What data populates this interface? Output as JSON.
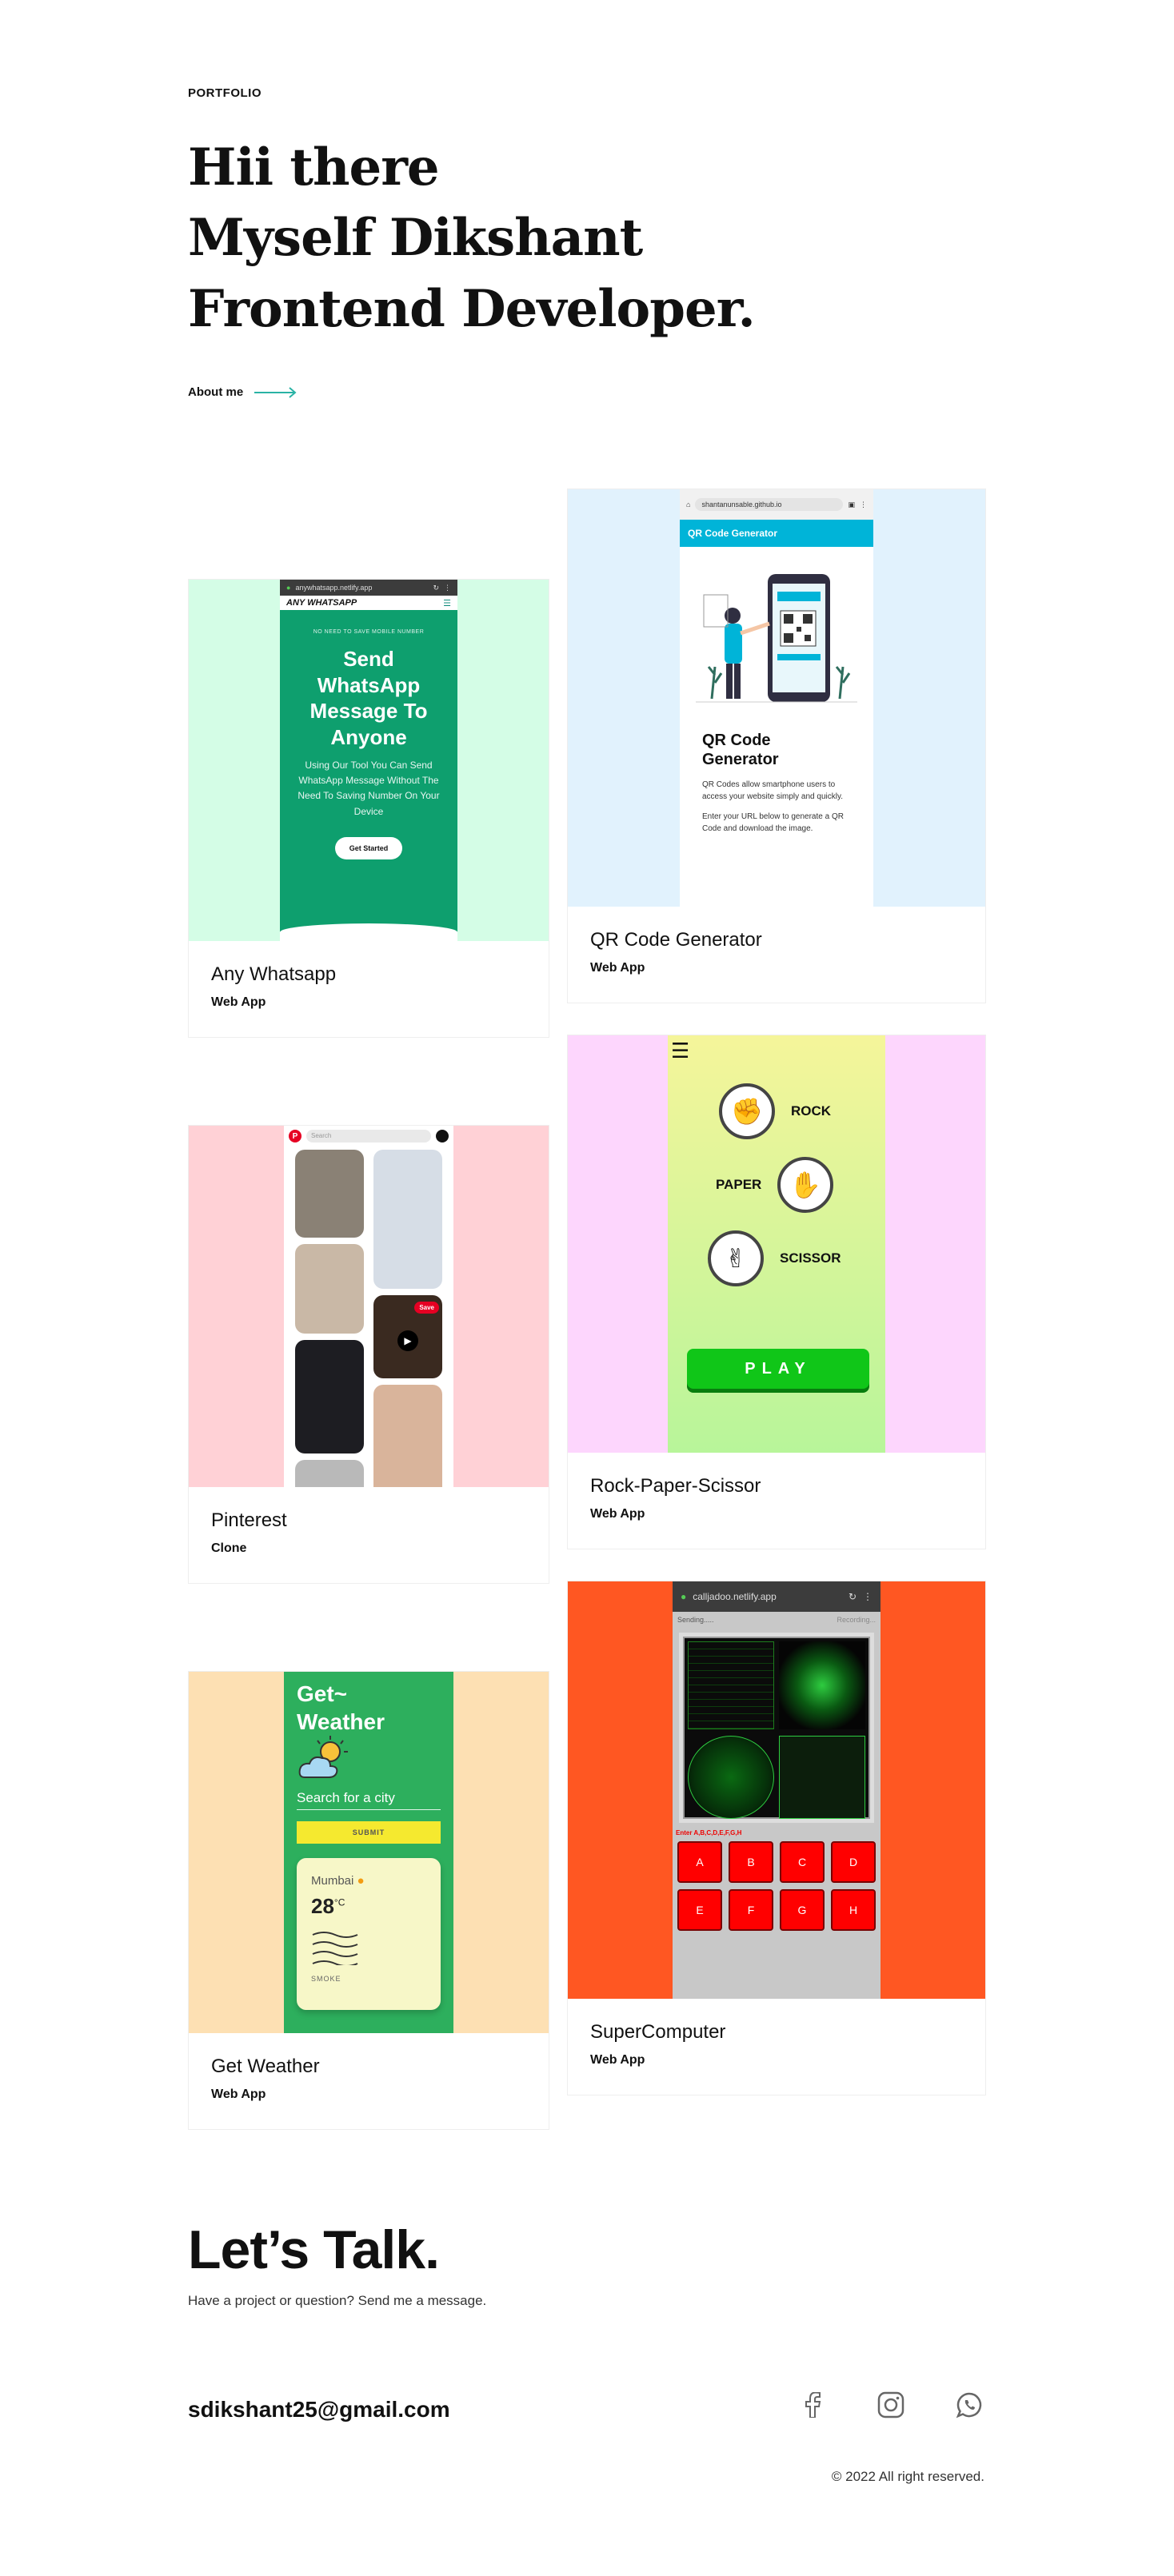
{
  "hero": {
    "kicker": "PORTFOLIO",
    "line1": "Hii there",
    "line2": "Myself Dikshant",
    "line3": "Frontend Developer.",
    "about_label": "About me"
  },
  "colors": {
    "highlight": "#b3f1e6",
    "accent": "#2ab3a5"
  },
  "projects": [
    {
      "title": "Any Whatsapp",
      "category": "Web App",
      "bg": "#d4fde6",
      "phone_url": "anywhatsapp.netlify.app",
      "brand": "ANY WHATSAPP",
      "tagline": "NO NEED TO SAVE MOBILE NUMBER",
      "headline": "Send WhatsApp Message To Anyone",
      "body": "Using Our Tool You Can Send WhatsApp Message Without The Need To Saving Number On Your Device",
      "cta": "Get Started"
    },
    {
      "title": "QR Code Generator",
      "category": "Web App",
      "bg": "#e1f2fd",
      "phone_url": "shantanunsable.github.io",
      "app_bar": "QR Code Generator",
      "heading": "QR Code Generator",
      "p1": "QR Codes allow smartphone users to access your website simply and quickly.",
      "p2": "Enter your URL below to generate a QR Code and download the image."
    },
    {
      "title": "Pinterest",
      "category": "Clone",
      "bg": "#ffd1d6",
      "search_placeholder": "Search",
      "save_label": "Save"
    },
    {
      "title": "Rock-Paper-Scissor",
      "category": "Web App",
      "bg": "#fdd6fd",
      "rock": "ROCK",
      "paper": "PAPER",
      "scissor": "SCISSOR",
      "play": "PLAY"
    },
    {
      "title": "Get Weather",
      "category": "Web App",
      "bg": "#fde0b3",
      "app_title": "Get~ Weather",
      "search_placeholder": "Search for a city",
      "submit": "SUBMIT",
      "city": "Mumbai",
      "temp": "28",
      "unit": "°C",
      "condition": "SMOKE"
    },
    {
      "title": "SuperComputer",
      "category": "Web App",
      "bg": "#ff5722",
      "phone_url": "calljadoo.netlify.app",
      "status_left": "Sending.....",
      "status_right": "Recording...",
      "screen_label": "Enter A,B,C,D,E,F,G,H",
      "keys": [
        "A",
        "B",
        "C",
        "D",
        "E",
        "F",
        "G",
        "H"
      ]
    }
  ],
  "talk": {
    "title": "Let’s Talk.",
    "subtitle": "Have a project or question? Send me a message.",
    "email": "sdikshant25@gmail.com"
  },
  "socials": [
    "facebook-icon",
    "instagram-icon",
    "whatsapp-icon"
  ],
  "footer": {
    "copyright": "© 2022 All right reserved."
  }
}
